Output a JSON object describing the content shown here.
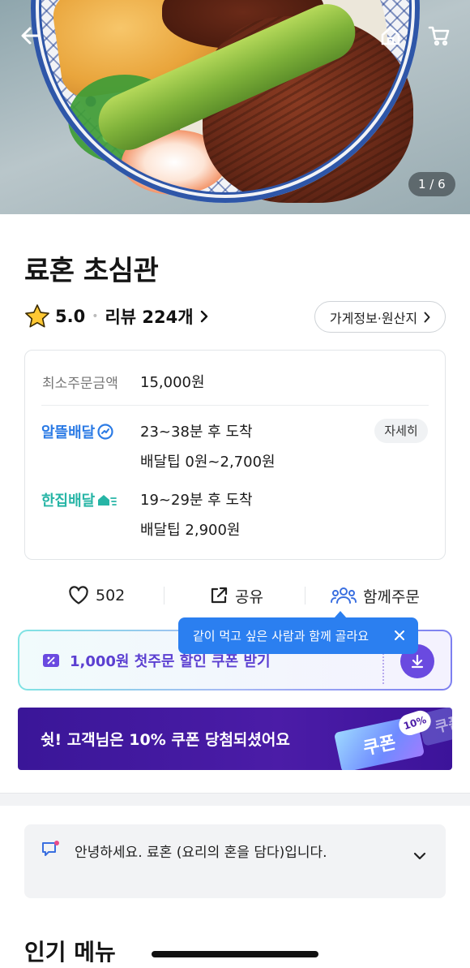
{
  "hero": {
    "page_counter": "1 / 6",
    "icons": {
      "back": "back-arrow-icon",
      "home": "home-icon",
      "cart": "cart-icon"
    }
  },
  "store": {
    "name": "료혼 초심관",
    "rating": "5.0",
    "review_label": "리뷰 224개",
    "info_button": "가게정보·원산지"
  },
  "delivery": {
    "min_order_label": "최소주문금액",
    "min_order_value": "15,000원",
    "options": [
      {
        "brand": "알뜰배달",
        "eta": "23~38분 후 도착",
        "tip": "배달팁 0원~2,700원",
        "detail": "자세히"
      },
      {
        "brand": "한집배달",
        "eta": "19~29분 후 도착",
        "tip": "배달팁 2,900원"
      }
    ]
  },
  "actions": {
    "like_count": "502",
    "share_label": "공유",
    "group_order_label": "함께주문"
  },
  "tooltip": {
    "text": "같이 먹고 싶은 사람과 함께 골라요"
  },
  "coupon": {
    "label": "1,000원 첫주문 할인 쿠폰 받기"
  },
  "promo": {
    "text": "쉿! 고객님은 10% 쿠폰 당첨되셨어요",
    "ticket_text": "쿠폰",
    "ticket_badge": "10%"
  },
  "notice": {
    "text": "안녕하세요. 료혼 (요리의 혼을 담다)입니다."
  },
  "popular_menu": {
    "title": "인기 메뉴"
  },
  "colors": {
    "brand_blue": "#2c7be5",
    "brand_teal": "#27b5a6",
    "tooltip_blue": "#2b7ff0",
    "coupon_purple": "#5b3fd1",
    "promo_purple": "#4b1ca7"
  }
}
